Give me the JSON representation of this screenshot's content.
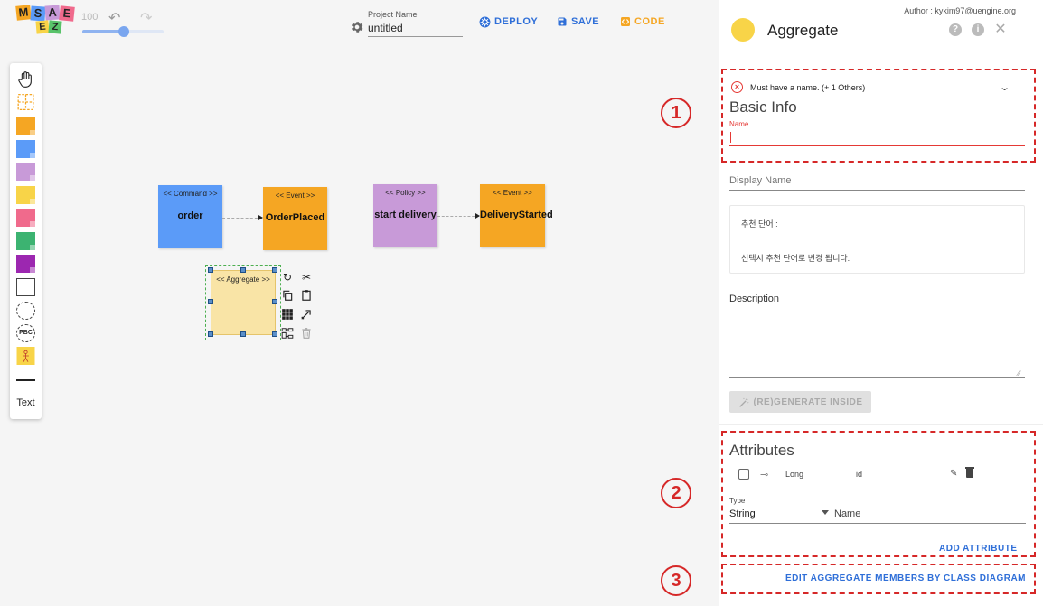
{
  "logo": {
    "letters": [
      "M",
      "S",
      "A",
      "E",
      "Z"
    ]
  },
  "toolbar": {
    "zoom": "100",
    "project_label": "Project Name",
    "project_value": "untitled",
    "deploy_label": "DEPLOY",
    "save_label": "SAVE",
    "code_label": "CODE"
  },
  "palette": {
    "colors": {
      "command": "#5b9bf8",
      "event": "#f5a623",
      "policy": "#c89ad8",
      "aggregate": "#f8d448",
      "pink": "#f06a8c",
      "green": "#3cb371",
      "purple": "#9c27b0"
    },
    "items": [
      "hand-icon",
      "bounded-context-grid-icon",
      "event-sticker",
      "command-sticker",
      "policy-sticker",
      "aggregate-sticker",
      "external-sticker",
      "readmodel-sticker",
      "ui-sticker",
      "note-sticker",
      "bounded-context-icon",
      "pbc-icon",
      "actor-sticker",
      "line-tool"
    ],
    "pbc": "PBC",
    "text_tool": "Text"
  },
  "canvas": {
    "nodes": [
      {
        "stereo": "<< Command >>",
        "label": "order"
      },
      {
        "stereo": "<< Event >>",
        "label": "OrderPlaced"
      },
      {
        "stereo": "<< Policy >>",
        "label": "start delivery"
      },
      {
        "stereo": "<< Event >>",
        "label": "DeliveryStarted"
      },
      {
        "stereo": "<< Aggregate >>",
        "label": ""
      }
    ]
  },
  "panel": {
    "author": "Author : kykim97@uengine.org",
    "title": "Aggregate",
    "error": "Must have a name. (+ 1 Others)",
    "basic_info": "Basic Info",
    "name_label": "Name",
    "name_value": "",
    "display_name_placeholder": "Display Name",
    "recommend_title": "추천 단어 :",
    "recommend_hint": "선택시 추천 단어로 변경 됩니다.",
    "description_label": "Description",
    "regenerate_label": "(RE)GENERATE INSIDE",
    "attributes_title": "Attributes",
    "attribute_rows": [
      {
        "type": "Long",
        "name": "id"
      }
    ],
    "type_label": "Type",
    "type_value": "String",
    "new_name_label": "Name",
    "add_attribute_label": "ADD ATTRIBUTE",
    "edit_class_label": "EDIT AGGREGATE MEMBERS BY CLASS DIAGRAM"
  },
  "annotations": {
    "callouts": [
      "1",
      "2",
      "3"
    ],
    "color": "#d62828"
  }
}
